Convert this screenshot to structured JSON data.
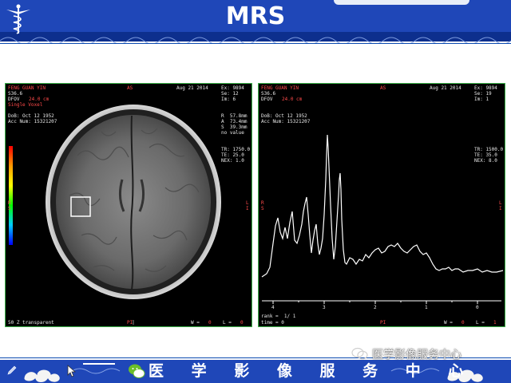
{
  "header": {
    "title": "MRS"
  },
  "left_panel": {
    "patient_name": "FENG GUAN YIN",
    "study_id": "S36.6",
    "dfov_label": "DFOV",
    "dfov_value": "24.0 cm",
    "series_desc": "Single Voxel",
    "dob": "DoB: Oct 12 1952",
    "acc": "Acc Num: 15321207",
    "orientation_top": "AS",
    "date": "Aug 21 2014",
    "ex": "Ex: 9894",
    "se": "Se: 12",
    "im": "Im: 6",
    "coord_r": "R  57.8mm",
    "coord_a": "A  73.4mm",
    "coord_s": "S  39.3mm",
    "no_value": "no value",
    "tr": "TR: 1750.0",
    "te": "TE: 25.0",
    "nex": "NEX: 1.0",
    "colorbar_mid": "R S",
    "side_right": "L I",
    "bottom_left": "50 Z transparent",
    "bottom_mid": "PI",
    "window": "W =",
    "window_value": "0",
    "level": "L =",
    "level_value": "0"
  },
  "right_panel": {
    "patient_name": "FENG GUAN YIN",
    "study_id": "S36.6",
    "dfov_label": "DFOV",
    "dfov_value": "24.0 cm",
    "dob": "DoB: Oct 12 1952",
    "acc": "Acc Num: 15321207",
    "orientation_top": "AS",
    "date": "Aug 21 2014",
    "ex": "Ex: 9894",
    "se": "Se: 19",
    "im": "Im: 1",
    "tr": "TR: 1500.0",
    "te": "TE: 35.0",
    "nex": "NEX: 8.0",
    "side_left": "R S",
    "side_right": "L I",
    "axis_ticks": [
      "4",
      "3",
      "2",
      "1",
      "0"
    ],
    "rank": "rank =  1/ 1",
    "time": "time = 0",
    "bottom_mid": "PI",
    "window": "W =",
    "window_value": "0",
    "level": "L =",
    "level_value": "1"
  },
  "footer": {
    "text": "医 学 影 像 服 务 中 心",
    "watermark": "医学影像服务中心"
  },
  "colors": {
    "brand_blue": "#1f47b8",
    "panel_border": "#3db34a",
    "overlay_red": "#ff4a4a",
    "wechat_green": "#6bbf2a"
  },
  "icons": [
    "caduceus-icon",
    "wechat-icon",
    "pencil-icon",
    "cursor-icon",
    "cloud-ornament-icon"
  ]
}
